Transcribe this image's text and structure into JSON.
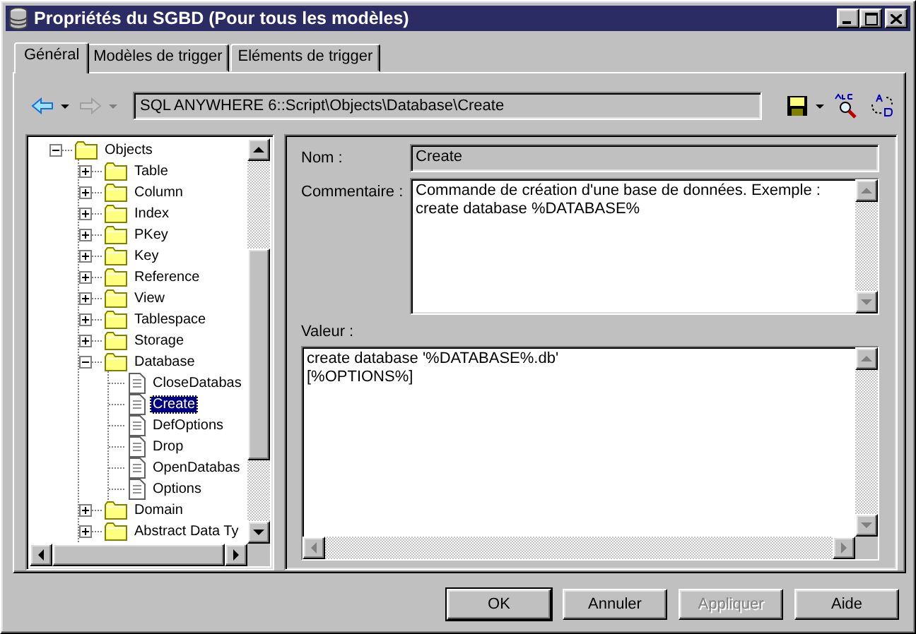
{
  "window": {
    "title": "Propriétés du SGBD (Pour tous les modèles)"
  },
  "tabs": [
    {
      "label": "Général",
      "selected": true
    },
    {
      "label": "Modèles de trigger",
      "selected": false
    },
    {
      "label": "Eléments de trigger",
      "selected": false
    }
  ],
  "toolbar": {
    "back_disabled": false,
    "forward_disabled": true,
    "path": "SQL ANYWHERE 6::Script\\Objects\\Database\\Create"
  },
  "tree": [
    {
      "label": "Objects",
      "kind": "folder",
      "expanded": true,
      "selected": false,
      "children": [
        {
          "label": "Table",
          "kind": "folder",
          "expanded": false,
          "selected": false
        },
        {
          "label": "Column",
          "kind": "folder",
          "expanded": false,
          "selected": false
        },
        {
          "label": "Index",
          "kind": "folder",
          "expanded": false,
          "selected": false
        },
        {
          "label": "PKey",
          "kind": "folder",
          "expanded": false,
          "selected": false
        },
        {
          "label": "Key",
          "kind": "folder",
          "expanded": false,
          "selected": false
        },
        {
          "label": "Reference",
          "kind": "folder",
          "expanded": false,
          "selected": false
        },
        {
          "label": "View",
          "kind": "folder",
          "expanded": false,
          "selected": false
        },
        {
          "label": "Tablespace",
          "kind": "folder",
          "expanded": false,
          "selected": false
        },
        {
          "label": "Storage",
          "kind": "folder",
          "expanded": false,
          "selected": false
        },
        {
          "label": "Database",
          "kind": "folder",
          "expanded": true,
          "selected": false,
          "children": [
            {
              "label": "CloseDatabas",
              "kind": "script",
              "selected": false
            },
            {
              "label": "Create",
              "kind": "script",
              "selected": true
            },
            {
              "label": "DefOptions",
              "kind": "script",
              "selected": false
            },
            {
              "label": "Drop",
              "kind": "script",
              "selected": false
            },
            {
              "label": "OpenDatabas",
              "kind": "script",
              "selected": false
            },
            {
              "label": "Options",
              "kind": "script",
              "selected": false
            }
          ]
        },
        {
          "label": "Domain",
          "kind": "folder",
          "expanded": false,
          "selected": false
        },
        {
          "label": "Abstract Data Ty",
          "kind": "folder",
          "expanded": false,
          "selected": false
        }
      ]
    }
  ],
  "fields": [
    {
      "label": "Nom :",
      "value": "Create",
      "kind": "line",
      "disabled": true
    },
    {
      "label": "Commentaire :",
      "value": "Commande de création d'une base de données. Exemple : create database %DATABASE%",
      "kind": "memo",
      "disabled": false
    },
    {
      "label": "Valeur :",
      "value": "create database '%DATABASE%.db'\n[%OPTIONS%]",
      "kind": "code",
      "disabled": false
    }
  ],
  "buttons": [
    {
      "label": "OK",
      "default": true,
      "disabled": false
    },
    {
      "label": "Annuler",
      "default": false,
      "disabled": false
    },
    {
      "label": "Appliquer",
      "default": false,
      "disabled": true
    },
    {
      "label": "Aide",
      "default": false,
      "disabled": false
    }
  ]
}
